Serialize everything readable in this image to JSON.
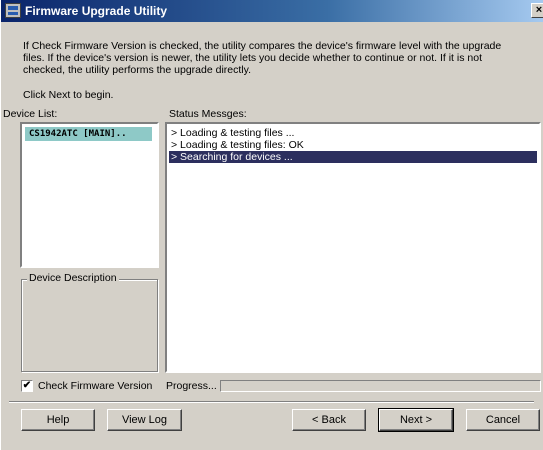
{
  "window": {
    "title": "Firmware Upgrade Utility",
    "close_label": "×",
    "icon": "app-icon"
  },
  "intro": {
    "text": "If Check Firmware Version is checked, the utility compares the device's firmware level with the upgrade files. If the device's version is newer, the utility lets you decide whether to continue or not. If it is not checked, the utility performs the upgrade directly.",
    "click_next": "Click Next to begin."
  },
  "device_list": {
    "label": "Device List:",
    "items": [
      "CS1942ATC [MAIN].."
    ]
  },
  "status": {
    "label": "Status Messges:",
    "messages": [
      "> Loading & testing files ...",
      "> Loading & testing files: OK",
      "> Searching for devices ..."
    ]
  },
  "device_description": {
    "label": "Device Description"
  },
  "options": {
    "check_firmware_label": "Check Firmware Version",
    "check_firmware_checked": true,
    "check_mark": "✔",
    "progress_label": "Progress...",
    "progress_value": 0
  },
  "buttons": {
    "help": "Help",
    "view_log": "View Log",
    "back": "< Back",
    "next": "Next >",
    "cancel": "Cancel"
  },
  "colors": {
    "title_bar": "#0a246a",
    "selection": "#2c2f5e",
    "device_highlight": "#8ec9c7",
    "face": "#d4d0c8"
  }
}
